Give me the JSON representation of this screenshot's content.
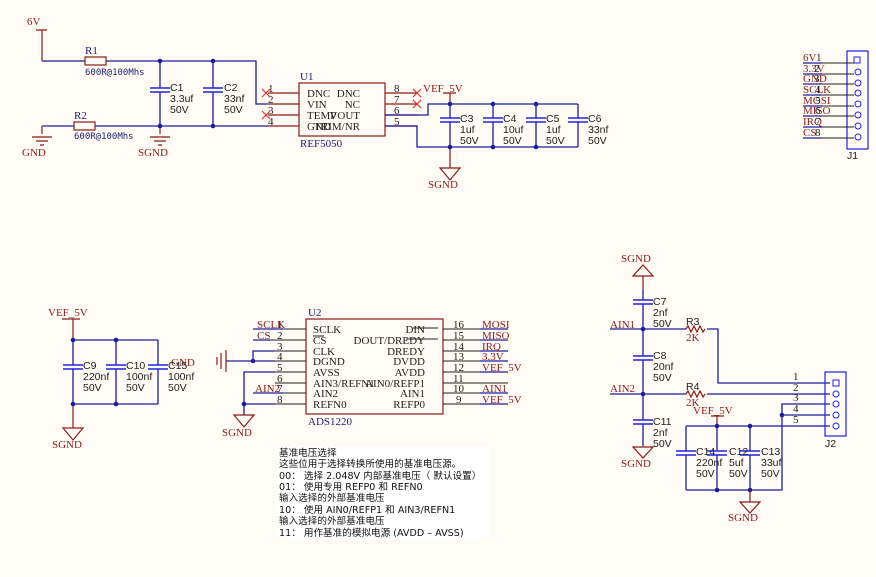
{
  "power_section": {
    "supply_label": "6V",
    "r1": {
      "designator": "R1",
      "value": "600R@100Mhs"
    },
    "r2": {
      "designator": "R2",
      "value": "600R@100Mhs"
    },
    "c1": {
      "designator": "C1",
      "value": "3.3uf",
      "voltage": "50V"
    },
    "c2": {
      "designator": "C2",
      "value": "33nf",
      "voltage": "50V"
    },
    "gnd_label": "GND",
    "sgnd_label": "SGND"
  },
  "u1": {
    "designator": "U1",
    "part": "REF5050",
    "left_pins": [
      {
        "num": "1",
        "name": "DNC"
      },
      {
        "num": "2",
        "name": "VIN"
      },
      {
        "num": "3",
        "name": "TEMP"
      },
      {
        "num": "4",
        "name": "GND"
      }
    ],
    "right_pins": [
      {
        "num": "8",
        "name": "DNC"
      },
      {
        "num": "7",
        "name": "NC"
      },
      {
        "num": "6",
        "name": "VOUT"
      },
      {
        "num": "5",
        "name": "TRIM/NR"
      }
    ],
    "net_label": "VEF_5V",
    "sgnd_label": "SGND"
  },
  "ref_caps": [
    {
      "designator": "C3",
      "value": "1uf",
      "voltage": "50V"
    },
    {
      "designator": "C4",
      "value": "10uf",
      "voltage": "50V"
    },
    {
      "designator": "C5",
      "value": "1uf",
      "voltage": "50V"
    },
    {
      "designator": "C6",
      "value": "33nf",
      "voltage": "50V"
    }
  ],
  "j1": {
    "designator": "J1",
    "pins": [
      {
        "num": "1",
        "net": "6V"
      },
      {
        "num": "2",
        "net": "3.3V"
      },
      {
        "num": "3",
        "net": "GND"
      },
      {
        "num": "4",
        "net": "SCLK"
      },
      {
        "num": "5",
        "net": "MOSI"
      },
      {
        "num": "6",
        "net": "MISO"
      },
      {
        "num": "7",
        "net": "IRQ"
      },
      {
        "num": "8",
        "net": "CS"
      }
    ]
  },
  "decoupling": {
    "net_label": "VEF_5V",
    "sgnd_label": "SGND",
    "stray_label": "GND",
    "caps": [
      {
        "designator": "C9",
        "value": "220nf",
        "voltage": "50V"
      },
      {
        "designator": "C10",
        "value": "100nf",
        "voltage": "50V"
      },
      {
        "designator": "C15",
        "value": "100nf",
        "voltage": "50V"
      }
    ]
  },
  "u2": {
    "designator": "U2",
    "part": "ADS1220",
    "sgnd_label": "SGND",
    "left_pins": [
      {
        "num": "1",
        "name": "SCLK",
        "net": "SCLK"
      },
      {
        "num": "2",
        "name": "CS",
        "net": "CS"
      },
      {
        "num": "3",
        "name": "CLK",
        "net": ""
      },
      {
        "num": "4",
        "name": "DGND",
        "net": ""
      },
      {
        "num": "5",
        "name": "AVSS",
        "net": ""
      },
      {
        "num": "6",
        "name": "AIN3/REFN1",
        "net": ""
      },
      {
        "num": "7",
        "name": "AIN2",
        "net": "AIN2"
      },
      {
        "num": "8",
        "name": "REFN0",
        "net": ""
      }
    ],
    "right_pins": [
      {
        "num": "16",
        "name": "DIN",
        "net": "MOSI"
      },
      {
        "num": "15",
        "name": "DOUT/DREDY",
        "net": "MISO"
      },
      {
        "num": "14",
        "name": "DREDY",
        "net": "IRQ"
      },
      {
        "num": "13",
        "name": "DVDD",
        "net": "3.3V"
      },
      {
        "num": "12",
        "name": "AVDD",
        "net": "VEF_5V"
      },
      {
        "num": "11",
        "name": "AIN0/REFP1",
        "net": ""
      },
      {
        "num": "10",
        "name": "AIN1",
        "net": "AIN1"
      },
      {
        "num": "9",
        "name": "REFP0",
        "net": "VEF_5V"
      }
    ]
  },
  "note": {
    "lines": [
      "基准电压选择",
      "这些位用于选择转换所使用的基准电压源。",
      "00：  选择 2.048V 内部基准电压（ 默认设置）",
      "01：  使用专用 REFP0 和 REFN0",
      "输入选择的外部基准电压",
      "10：  使用 AIN0/REFP1 和 AIN3/REFN1",
      "输入选择的外部基准电压",
      "11：  用作基准的模拟电源 (AVDD – AVSS)"
    ]
  },
  "input_section": {
    "sgnd_top": "SGND",
    "sgnd_mid": "SGND",
    "sgnd_bottom": "SGND",
    "ain1": "AIN1",
    "ain2": "AIN2",
    "vef": "VEF_5V",
    "c7": {
      "designator": "C7",
      "value": "2nf",
      "voltage": "50V"
    },
    "c8": {
      "designator": "C8",
      "value": "20nf",
      "voltage": "50V"
    },
    "c11": {
      "designator": "C11",
      "value": "2nf",
      "voltage": "50V"
    },
    "r3": {
      "designator": "R3",
      "value": "2K"
    },
    "r4": {
      "designator": "R4",
      "value": "2K"
    },
    "c14": {
      "designator": "C14",
      "value": "220nf",
      "voltage": "50V"
    },
    "c12": {
      "designator": "C12",
      "value": "5uf",
      "voltage": "50V"
    },
    "c13": {
      "designator": "C13",
      "value": "33uf",
      "voltage": "50V"
    },
    "j2": {
      "designator": "J2",
      "pins": [
        "1",
        "2",
        "3",
        "4",
        "5"
      ]
    }
  }
}
